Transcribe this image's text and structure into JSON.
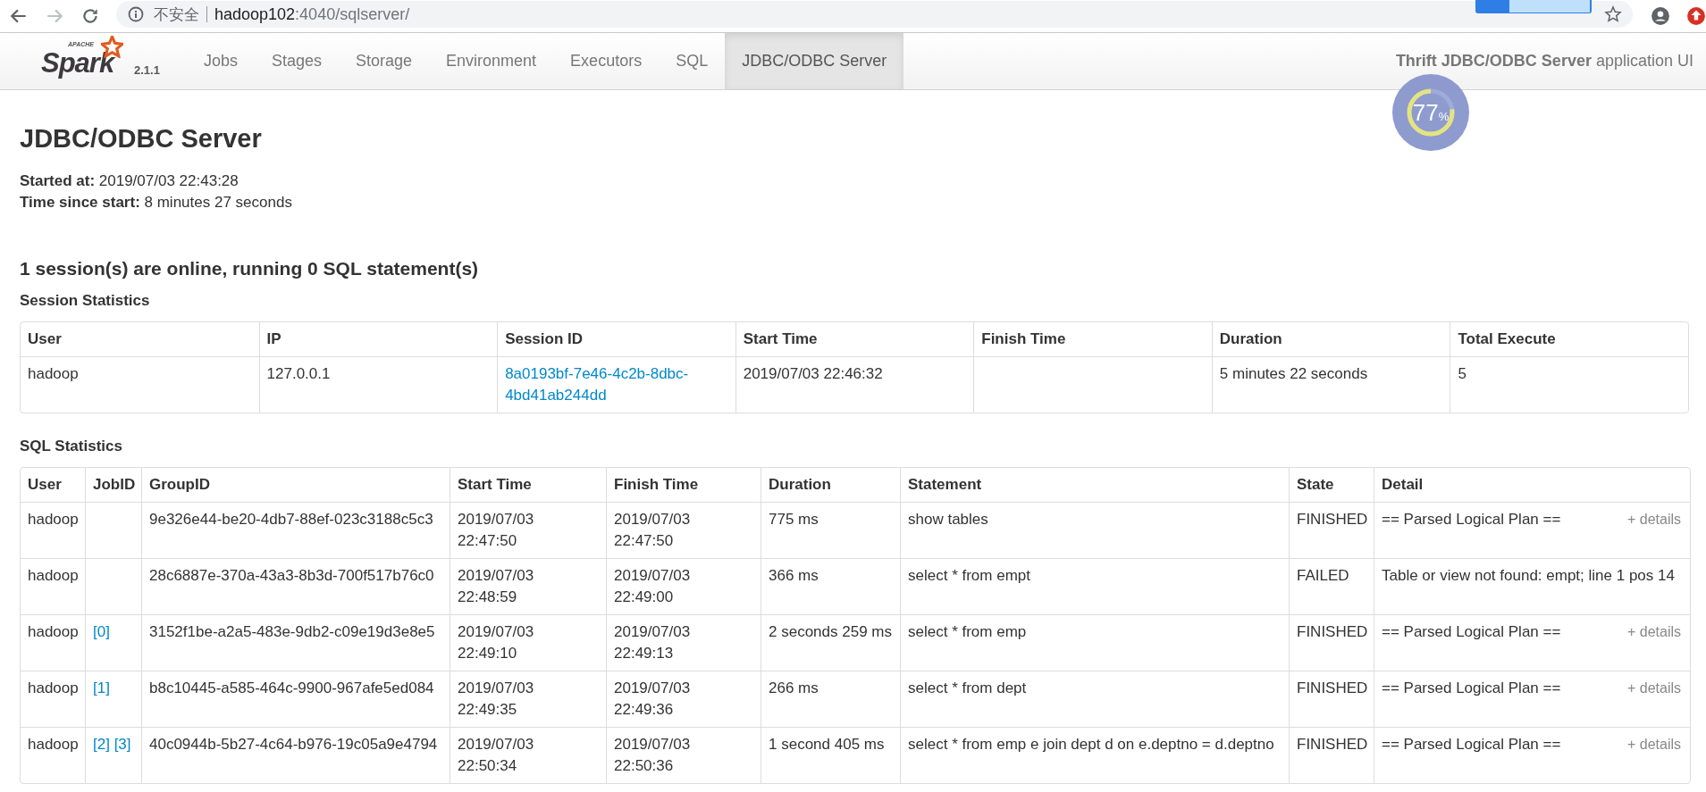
{
  "browser": {
    "security_label": "不安全",
    "url_host": "hadoop102",
    "url_path": ":4040/sqlserver/"
  },
  "navbar": {
    "logo_small": "APACHE",
    "logo_name": "Spark",
    "version": "2.1.1",
    "tabs": [
      {
        "label": "Jobs",
        "selected": false
      },
      {
        "label": "Stages",
        "selected": false
      },
      {
        "label": "Storage",
        "selected": false
      },
      {
        "label": "Environment",
        "selected": false
      },
      {
        "label": "Executors",
        "selected": false
      },
      {
        "label": "SQL",
        "selected": false
      },
      {
        "label": "JDBC/ODBC Server",
        "selected": true
      }
    ],
    "app_title": "**Thrift JDBC/ODBC Server** application UI"
  },
  "speed_widget": {
    "value": "77",
    "unit": "%"
  },
  "page": {
    "title": "JDBC/ODBC Server",
    "info": [
      {
        "label": "Started at:",
        "value": "2019/07/03 22:43:28"
      },
      {
        "label": "Time since start:",
        "value": "8 minutes 27 seconds"
      }
    ],
    "summary": "1 session(s) are online, running 0 SQL statement(s)"
  },
  "session_table": {
    "title": "Session Statistics",
    "columns": [
      "User",
      "IP",
      "Session ID",
      "Start Time",
      "Finish Time",
      "Duration",
      "Total Execute"
    ],
    "rows": [
      {
        "user": "hadoop",
        "ip": "127.0.0.1",
        "session_id": "8a0193bf-7e46-4c2b-8dbc-4bd41ab244dd",
        "start_time": "2019/07/03 22:46:32",
        "duration": "5 minutes 22 seconds",
        "total_execute": "5"
      }
    ]
  },
  "sql_table": {
    "title": "SQL Statistics",
    "columns": [
      "User",
      "JobID",
      "GroupID",
      "Start Time",
      "Finish Time",
      "Duration",
      "Statement",
      "State",
      "Detail"
    ],
    "rows": [
      {
        "user": "hadoop",
        "job_ids": [],
        "group_id": "9e326e44-be20-4db7-88ef-023c3188c5c3",
        "start_time": "2019/07/03 22:47:50",
        "finish_time": "2019/07/03 22:47:50",
        "duration": "775 ms",
        "statement": "show tables",
        "state": "FINISHED",
        "detail": "== Parsed Logical Plan ==",
        "details_link": "+ details"
      },
      {
        "user": "hadoop",
        "job_ids": [],
        "group_id": "28c6887e-370a-43a3-8b3d-700f517b76c0",
        "start_time": "2019/07/03 22:48:59",
        "finish_time": "2019/07/03 22:49:00",
        "duration": "366 ms",
        "statement": "select * from empt",
        "state": "FAILED",
        "detail": "Table or view not found: empt; line 1 pos 14"
      },
      {
        "user": "hadoop",
        "job_ids": [
          "[0]"
        ],
        "group_id": "3152f1be-a2a5-483e-9db2-c09e19d3e8e5",
        "start_time": "2019/07/03 22:49:10",
        "finish_time": "2019/07/03 22:49:13",
        "duration": "2 seconds 259 ms",
        "statement": "select * from emp",
        "state": "FINISHED",
        "detail": "== Parsed Logical Plan ==",
        "details_link": "+ details"
      },
      {
        "user": "hadoop",
        "job_ids": [
          "[1]"
        ],
        "group_id": "b8c10445-a585-464c-9900-967afe5ed084",
        "start_time": "2019/07/03 22:49:35",
        "finish_time": "2019/07/03 22:49:36",
        "duration": "266 ms",
        "statement": "select * from dept",
        "state": "FINISHED",
        "detail": "== Parsed Logical Plan ==",
        "details_link": "+ details"
      },
      {
        "user": "hadoop",
        "job_ids": [
          "[2]",
          "[3]"
        ],
        "group_id": "40c0944b-5b27-4c64-b976-19c05a9e4794",
        "start_time": "2019/07/03 22:50:34",
        "finish_time": "2019/07/03 22:50:36",
        "duration": "1 second 405 ms",
        "statement": "select * from emp e join dept d on e.deptno = d.deptno",
        "state": "FINISHED",
        "detail": "== Parsed Logical Plan ==",
        "details_link": "+ details"
      }
    ]
  }
}
